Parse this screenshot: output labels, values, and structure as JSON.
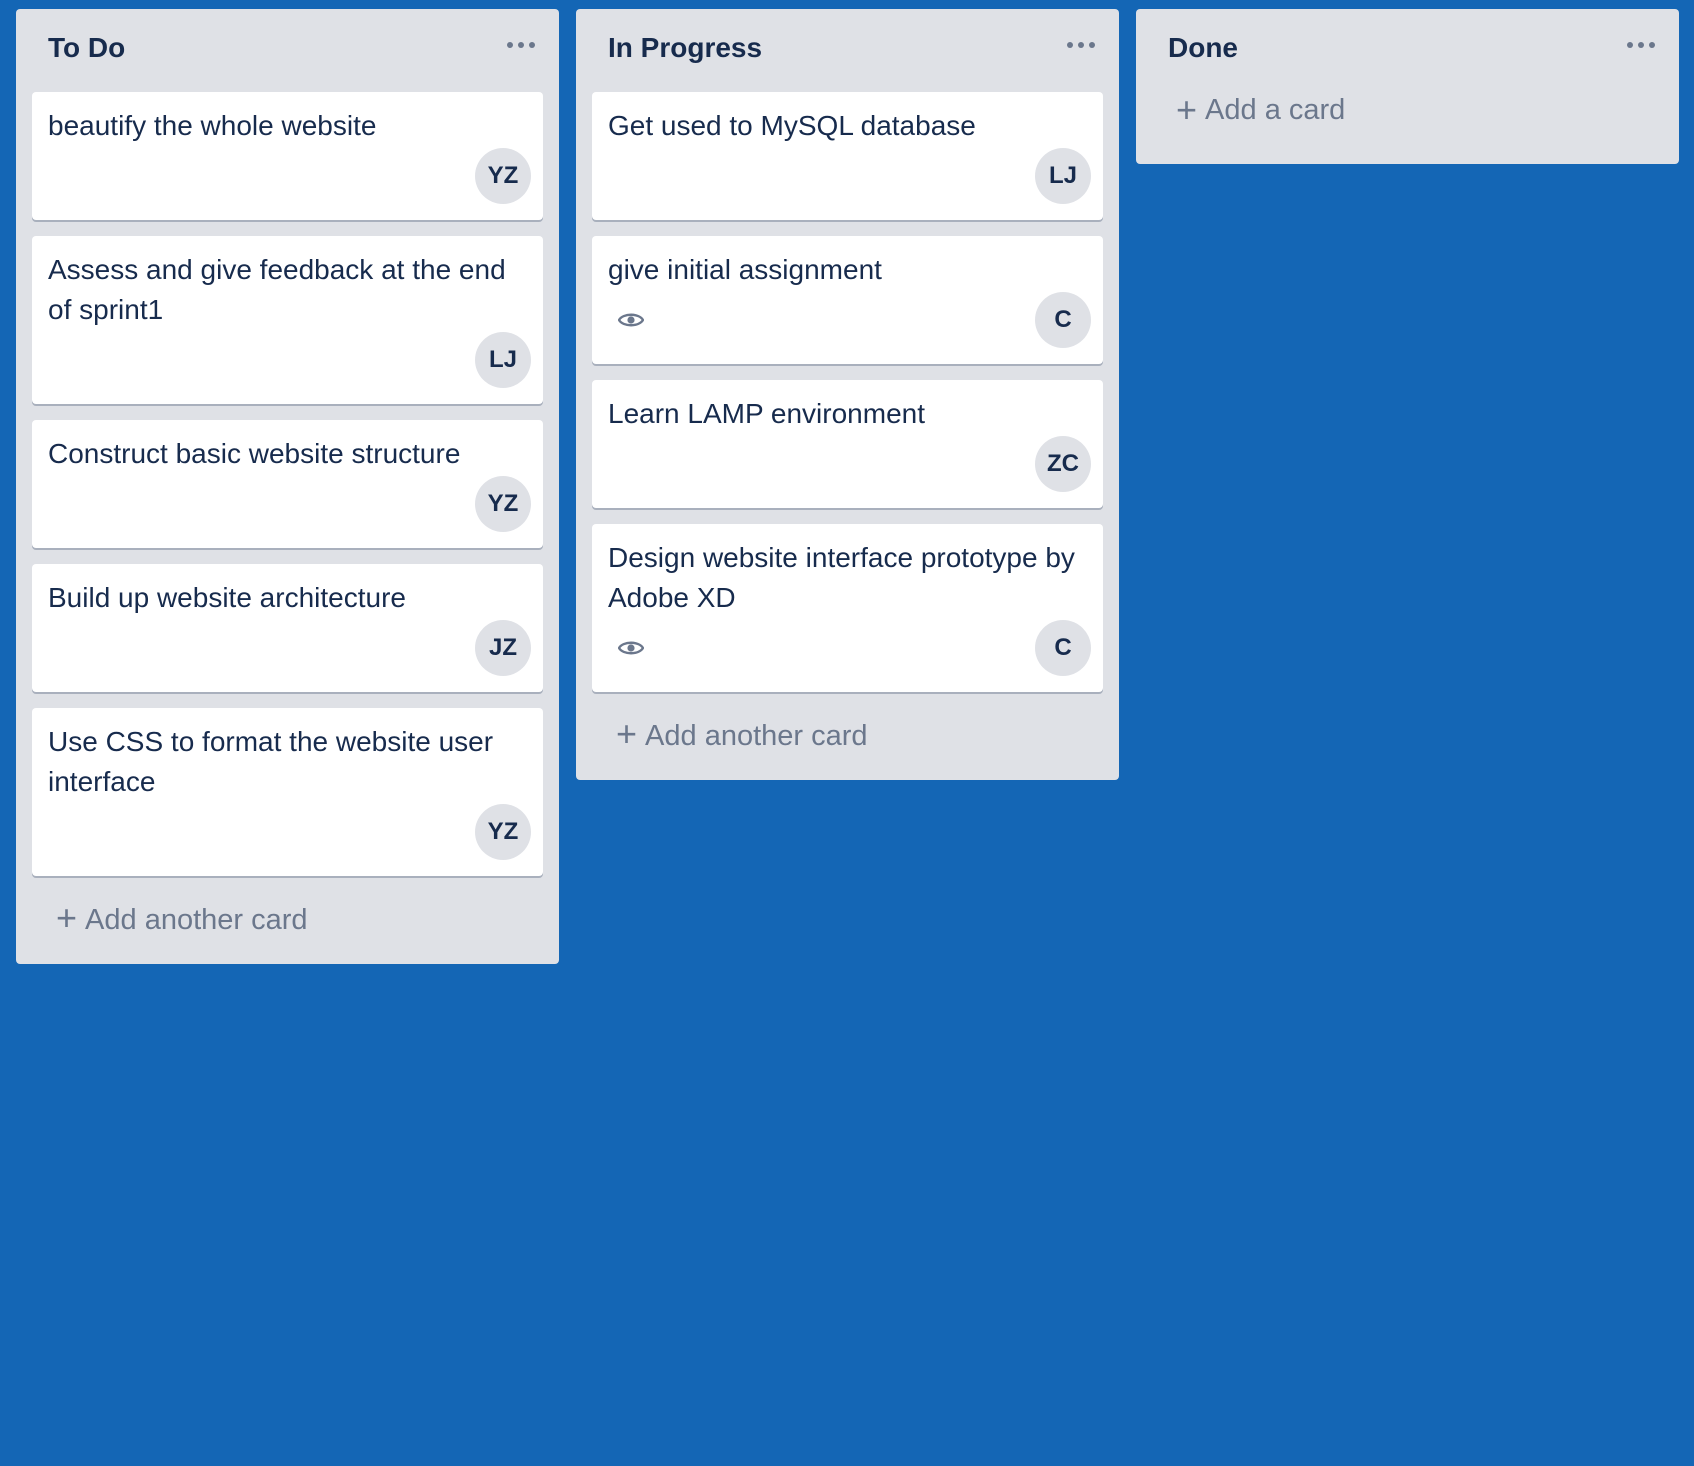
{
  "board": {
    "background_color": "#1466b5",
    "lists": [
      {
        "title": "To Do",
        "menu_icon": "more-horizontal-icon",
        "cards": [
          {
            "title": "beautify the whole website",
            "members": [
              "YZ"
            ],
            "watching": false
          },
          {
            "title": "Assess and give feedback at the end of sprint1",
            "members": [
              "LJ"
            ],
            "watching": false
          },
          {
            "title": "Construct basic website structure",
            "members": [
              "YZ"
            ],
            "watching": false
          },
          {
            "title": "Build up website architecture",
            "members": [
              "JZ"
            ],
            "watching": false
          },
          {
            "title": "Use CSS to format the website user interface",
            "members": [
              "YZ"
            ],
            "watching": false
          }
        ],
        "add_label": "Add another card"
      },
      {
        "title": "In Progress",
        "menu_icon": "more-horizontal-icon",
        "cards": [
          {
            "title": "Get used to MySQL database",
            "members": [
              "LJ"
            ],
            "watching": false
          },
          {
            "title": "give initial assignment",
            "members": [
              "C"
            ],
            "watching": true
          },
          {
            "title": "Learn LAMP environment",
            "members": [
              "ZC"
            ],
            "watching": false
          },
          {
            "title": "Design website interface prototype by Adobe XD",
            "members": [
              "C"
            ],
            "watching": true
          }
        ],
        "add_label": "Add another card"
      },
      {
        "title": "Done",
        "menu_icon": "more-horizontal-icon",
        "cards": [],
        "add_label": "Add a card"
      }
    ]
  },
  "icons": {
    "add": "plus-icon",
    "watch": "eye-icon"
  }
}
